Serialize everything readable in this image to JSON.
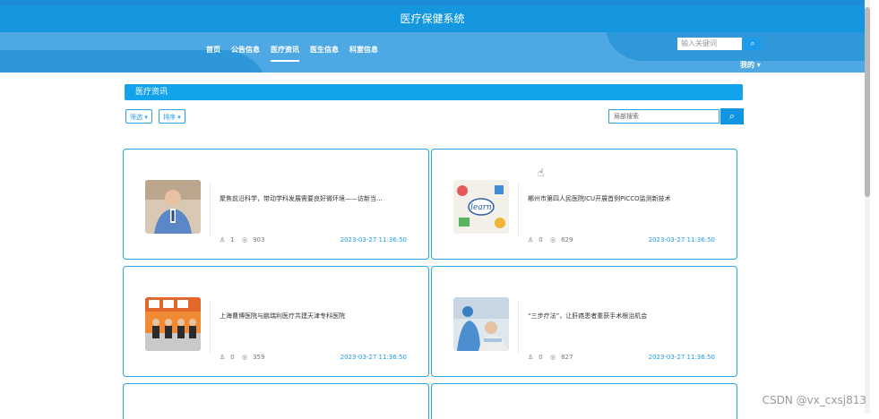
{
  "app": {
    "title": "医疗保健系统"
  },
  "nav": {
    "items": [
      "首页",
      "公告信息",
      "医疗资讯",
      "医生信息",
      "科室信息"
    ],
    "active_index": 2
  },
  "top_search": {
    "placeholder": "输入关键词"
  },
  "user_menu": {
    "label": "我的",
    "chevron": "▾"
  },
  "page_header": {
    "title": "医疗资讯"
  },
  "filters": {
    "filter_label": "筛选 ▾",
    "sort_label": "排序 ▾"
  },
  "local_search": {
    "placeholder": "局部搜索"
  },
  "articles": [
    {
      "title": "聚焦前沿科学，带动学科发展需要良好微环境——访新当...",
      "likes": "1",
      "views": "903",
      "date": "2023-03-27 11:36:50",
      "thumb": "doctor-portrait"
    },
    {
      "title": "郴州市第四人民医院ICU开展首例PICCO监测新技术",
      "likes": "0",
      "views": "629",
      "date": "2023-03-27 11:36:50",
      "thumb": "learn-illustration"
    },
    {
      "title": "上海曹博医院与鹏瑞利医疗共建天津专科医院",
      "likes": "0",
      "views": "359",
      "date": "2023-03-27 11:36:50",
      "thumb": "signing-ceremony"
    },
    {
      "title": "“三步疗法”，让肝癌患者重获手术根治机会",
      "likes": "0",
      "views": "827",
      "date": "2023-03-27 11:36:50",
      "thumb": "patient-care"
    }
  ],
  "icons": {
    "like": "♙",
    "views": "◎",
    "search": "⌕",
    "cursor": "☝"
  },
  "watermark": "CSDN @vx_cxsj813",
  "colors": {
    "primary": "#1597e0",
    "accent": "#27a1e6",
    "date": "#1b9be8"
  }
}
